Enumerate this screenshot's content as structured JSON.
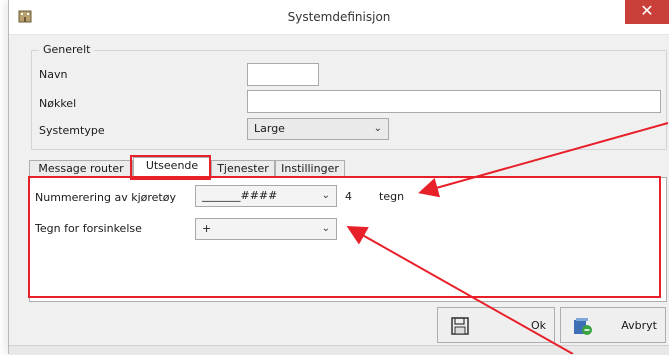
{
  "window": {
    "title": "Systemdefinisjon",
    "close_glyph": "✕",
    "app_icon": "building-app-icon"
  },
  "generelt": {
    "legend": "Generelt",
    "navn_label": "Navn",
    "navn_value": "",
    "nokkel_label": "Nøkkel",
    "nokkel_value": "",
    "systemtype_label": "Systemtype",
    "systemtype_value": "Large"
  },
  "tabs": [
    {
      "label": "Message router"
    },
    {
      "label": "Utseende"
    },
    {
      "label": "Tjenester"
    },
    {
      "label": "Instillinger"
    }
  ],
  "utseende": {
    "nummerering_label": "Nummerering av kjøretøy",
    "nummerering_value": "_______####",
    "count_value": "4",
    "count_unit": "tegn",
    "forsinkelse_label": "Tegn for forsinkelse",
    "forsinkelse_value": "+"
  },
  "buttons": {
    "ok_label": "Ok",
    "ok_icon": "save-disk-icon",
    "avbryt_label": "Avbryt",
    "avbryt_icon": "cancel-icon"
  },
  "colors": {
    "highlight": "#e8202a",
    "close_button": "#c9403a"
  }
}
